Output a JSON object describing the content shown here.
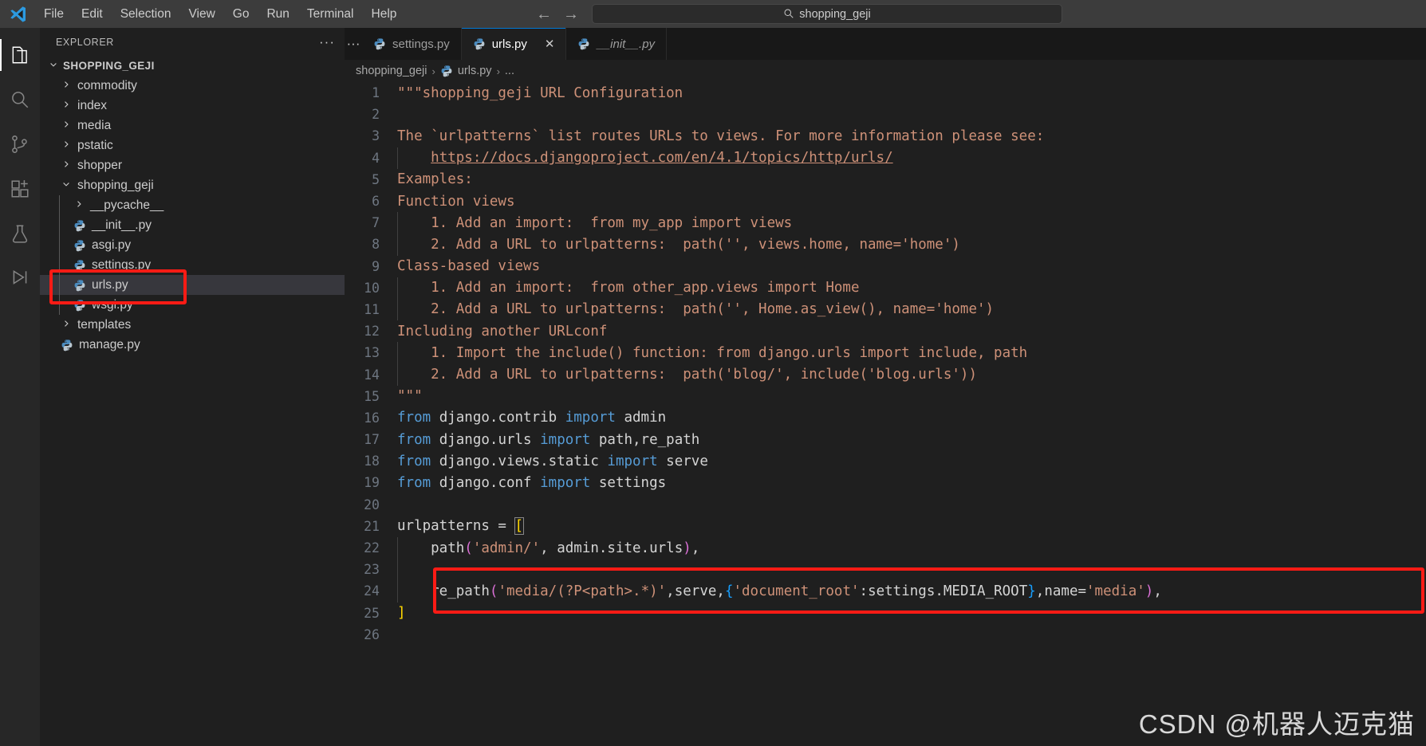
{
  "titlebar": {
    "logo_icon": "vscode-logo-icon",
    "menus": [
      "File",
      "Edit",
      "Selection",
      "View",
      "Go",
      "Run",
      "Terminal",
      "Help"
    ],
    "back_icon": "arrow-left-icon",
    "forward_icon": "arrow-right-icon",
    "command_center": {
      "icon": "search-icon",
      "value": "shopping_geji"
    }
  },
  "activitybar": {
    "items": [
      {
        "name": "explorer-icon",
        "label": "Explorer",
        "active": true
      },
      {
        "name": "search-icon",
        "label": "Search",
        "active": false
      },
      {
        "name": "source-control-icon",
        "label": "Source Control",
        "active": false
      },
      {
        "name": "extensions-icon",
        "label": "Extensions",
        "active": false
      },
      {
        "name": "testing-icon",
        "label": "Testing",
        "active": false
      },
      {
        "name": "run-debug-icon",
        "label": "Run and Debug",
        "active": false
      }
    ]
  },
  "sidebar": {
    "title": "EXPLORER",
    "more_actions": "···",
    "root": "SHOPPING_GEJI",
    "tree": [
      {
        "label": "commodity",
        "type": "folder",
        "expanded": false,
        "depth": 1,
        "selected": false
      },
      {
        "label": "index",
        "type": "folder",
        "expanded": false,
        "depth": 1,
        "selected": false
      },
      {
        "label": "media",
        "type": "folder",
        "expanded": false,
        "depth": 1,
        "selected": false
      },
      {
        "label": "pstatic",
        "type": "folder",
        "expanded": false,
        "depth": 1,
        "selected": false
      },
      {
        "label": "shopper",
        "type": "folder",
        "expanded": false,
        "depth": 1,
        "selected": false
      },
      {
        "label": "shopping_geji",
        "type": "folder",
        "expanded": true,
        "depth": 1,
        "selected": false
      },
      {
        "label": "__pycache__",
        "type": "folder",
        "expanded": false,
        "depth": 2,
        "selected": false
      },
      {
        "label": "__init__.py",
        "type": "python",
        "depth": 2,
        "selected": false
      },
      {
        "label": "asgi.py",
        "type": "python",
        "depth": 2,
        "selected": false
      },
      {
        "label": "settings.py",
        "type": "python",
        "depth": 2,
        "selected": false
      },
      {
        "label": "urls.py",
        "type": "python",
        "depth": 2,
        "selected": true
      },
      {
        "label": "wsgi.py",
        "type": "python",
        "depth": 2,
        "selected": false
      },
      {
        "label": "templates",
        "type": "folder",
        "expanded": false,
        "depth": 1,
        "selected": false
      },
      {
        "label": "manage.py",
        "type": "python",
        "depth": 1,
        "selected": false
      }
    ]
  },
  "editor": {
    "tabs": [
      {
        "label": "settings.py",
        "icon": "python-icon",
        "active": false,
        "preview": false,
        "closable": false
      },
      {
        "label": "urls.py",
        "icon": "python-icon",
        "active": true,
        "preview": false,
        "closable": true,
        "close_icon": "close-icon"
      },
      {
        "label": "__init__.py",
        "icon": "python-icon",
        "active": false,
        "preview": true,
        "closable": false
      }
    ],
    "breadcrumb": [
      "shopping_geji",
      "urls.py",
      "..."
    ],
    "breadcrumb_separator": "›",
    "lines": [
      {
        "n": 1,
        "text": "\"\"\"shopping_geji URL Configuration"
      },
      {
        "n": 2,
        "text": ""
      },
      {
        "n": 3,
        "text": "The `urlpatterns` list routes URLs to views. For more information please see:"
      },
      {
        "n": 4,
        "text": "    https://docs.djangoproject.com/en/4.1/topics/http/urls/"
      },
      {
        "n": 5,
        "text": "Examples:"
      },
      {
        "n": 6,
        "text": "Function views"
      },
      {
        "n": 7,
        "text": "    1. Add an import:  from my_app import views"
      },
      {
        "n": 8,
        "text": "    2. Add a URL to urlpatterns:  path('', views.home, name='home')"
      },
      {
        "n": 9,
        "text": "Class-based views"
      },
      {
        "n": 10,
        "text": "    1. Add an import:  from other_app.views import Home"
      },
      {
        "n": 11,
        "text": "    2. Add a URL to urlpatterns:  path('', Home.as_view(), name='home')"
      },
      {
        "n": 12,
        "text": "Including another URLconf"
      },
      {
        "n": 13,
        "text": "    1. Import the include() function: from django.urls import include, path"
      },
      {
        "n": 14,
        "text": "    2. Add a URL to urlpatterns:  path('blog/', include('blog.urls'))"
      },
      {
        "n": 15,
        "text": "\"\"\""
      },
      {
        "n": 16,
        "text": "from django.contrib import admin"
      },
      {
        "n": 17,
        "text": "from django.urls import path,re_path"
      },
      {
        "n": 18,
        "text": "from django.views.static import serve"
      },
      {
        "n": 19,
        "text": "from django.conf import settings"
      },
      {
        "n": 20,
        "text": ""
      },
      {
        "n": 21,
        "text": "urlpatterns = ["
      },
      {
        "n": 22,
        "text": "    path('admin/', admin.site.urls),"
      },
      {
        "n": 23,
        "text": ""
      },
      {
        "n": 24,
        "text": "    re_path('media/(?P<path>.*)',serve,{'document_root':settings.MEDIA_ROOT},name='media'),"
      },
      {
        "n": 25,
        "text": "]"
      },
      {
        "n": 26,
        "text": ""
      }
    ]
  },
  "annotations": {
    "color": "#fc1b15",
    "boxes": [
      {
        "name": "urls-py-sidebar-highlight"
      },
      {
        "name": "re-path-line-highlight"
      }
    ]
  },
  "watermark": "CSDN @机器人迈克猫"
}
